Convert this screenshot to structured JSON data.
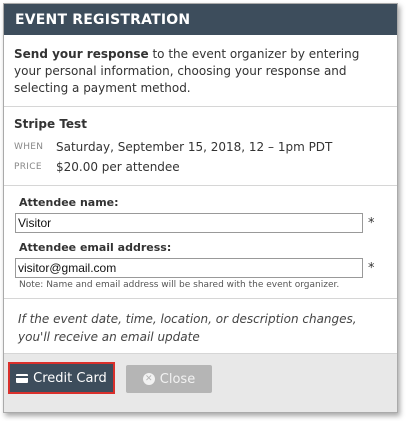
{
  "dialog": {
    "title": "EVENT REGISTRATION"
  },
  "intro": {
    "bold": "Send your response",
    "rest": " to the event organizer by entering your personal information, choosing your response and selecting a payment method."
  },
  "event": {
    "name": "Stripe Test",
    "when_label": "WHEN",
    "when_value": "Saturday, September 15, 2018, 12 – 1pm PDT",
    "price_label": "PRICE",
    "price_value": "$20.00 per attendee"
  },
  "form": {
    "name_label": "Attendee name:",
    "name_value": "Visitor",
    "email_label": "Attendee email address:",
    "email_value": "visitor@gmail.com",
    "required_mark": "*",
    "note": "Note: Name and email address will be shared with the event organizer."
  },
  "notice": "If the event date, time, location, or description changes, you'll receive an email update",
  "footer": {
    "credit_card_label": "Credit Card",
    "close_label": "Close"
  },
  "icons": {
    "credit_card": "credit-card-icon",
    "close": "close-circle-icon"
  },
  "colors": {
    "header": "#3d4d5c",
    "highlight": "#d9302c",
    "close_button": "#b5b5b5"
  }
}
